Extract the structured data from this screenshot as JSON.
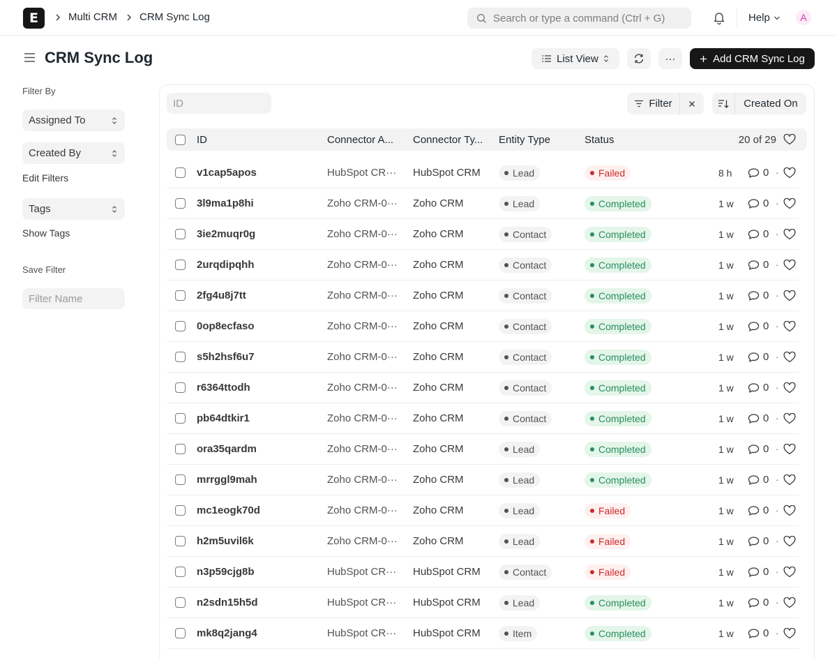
{
  "navbar": {
    "logo_letter": "E",
    "breadcrumbs": [
      "Multi CRM",
      "CRM Sync Log"
    ],
    "search_placeholder": "Search or type a command (Ctrl + G)",
    "help_label": "Help",
    "avatar_initial": "A"
  },
  "page": {
    "title": "CRM Sync Log",
    "list_view_label": "List View",
    "more_label": "···",
    "add_label": "Add CRM Sync Log"
  },
  "sidebar": {
    "filter_by_label": "Filter By",
    "assigned_to_label": "Assigned To",
    "created_by_label": "Created By",
    "edit_filters_label": "Edit Filters",
    "tags_label": "Tags",
    "show_tags_label": "Show Tags",
    "save_filter_label": "Save Filter",
    "filter_name_placeholder": "Filter Name"
  },
  "toolbar": {
    "id_placeholder": "ID",
    "filter_label": "Filter",
    "sort_label": "Created On"
  },
  "table": {
    "columns": [
      "ID",
      "Connector A...",
      "Connector Ty...",
      "Entity Type",
      "Status"
    ],
    "count_label": "20 of 29",
    "rows": [
      {
        "id": "v1cap5apos",
        "account": "HubSpot CR···",
        "type": "HubSpot CRM",
        "entity": "Lead",
        "status": "Failed",
        "status_kind": "red",
        "time": "8 h",
        "comments": "0"
      },
      {
        "id": "3l9ma1p8hi",
        "account": "Zoho CRM-0···",
        "type": "Zoho CRM",
        "entity": "Lead",
        "status": "Completed",
        "status_kind": "green",
        "time": "1 w",
        "comments": "0"
      },
      {
        "id": "3ie2muqr0g",
        "account": "Zoho CRM-0···",
        "type": "Zoho CRM",
        "entity": "Contact",
        "status": "Completed",
        "status_kind": "green",
        "time": "1 w",
        "comments": "0"
      },
      {
        "id": "2urqdipqhh",
        "account": "Zoho CRM-0···",
        "type": "Zoho CRM",
        "entity": "Contact",
        "status": "Completed",
        "status_kind": "green",
        "time": "1 w",
        "comments": "0"
      },
      {
        "id": "2fg4u8j7tt",
        "account": "Zoho CRM-0···",
        "type": "Zoho CRM",
        "entity": "Contact",
        "status": "Completed",
        "status_kind": "green",
        "time": "1 w",
        "comments": "0"
      },
      {
        "id": "0op8ecfaso",
        "account": "Zoho CRM-0···",
        "type": "Zoho CRM",
        "entity": "Contact",
        "status": "Completed",
        "status_kind": "green",
        "time": "1 w",
        "comments": "0"
      },
      {
        "id": "s5h2hsf6u7",
        "account": "Zoho CRM-0···",
        "type": "Zoho CRM",
        "entity": "Contact",
        "status": "Completed",
        "status_kind": "green",
        "time": "1 w",
        "comments": "0"
      },
      {
        "id": "r6364ttodh",
        "account": "Zoho CRM-0···",
        "type": "Zoho CRM",
        "entity": "Contact",
        "status": "Completed",
        "status_kind": "green",
        "time": "1 w",
        "comments": "0"
      },
      {
        "id": "pb64dtkir1",
        "account": "Zoho CRM-0···",
        "type": "Zoho CRM",
        "entity": "Contact",
        "status": "Completed",
        "status_kind": "green",
        "time": "1 w",
        "comments": "0"
      },
      {
        "id": "ora35qardm",
        "account": "Zoho CRM-0···",
        "type": "Zoho CRM",
        "entity": "Lead",
        "status": "Completed",
        "status_kind": "green",
        "time": "1 w",
        "comments": "0"
      },
      {
        "id": "mrrggl9mah",
        "account": "Zoho CRM-0···",
        "type": "Zoho CRM",
        "entity": "Lead",
        "status": "Completed",
        "status_kind": "green",
        "time": "1 w",
        "comments": "0"
      },
      {
        "id": "mc1eogk70d",
        "account": "Zoho CRM-0···",
        "type": "Zoho CRM",
        "entity": "Lead",
        "status": "Failed",
        "status_kind": "red",
        "time": "1 w",
        "comments": "0"
      },
      {
        "id": "h2m5uvil6k",
        "account": "Zoho CRM-0···",
        "type": "Zoho CRM",
        "entity": "Lead",
        "status": "Failed",
        "status_kind": "red",
        "time": "1 w",
        "comments": "0"
      },
      {
        "id": "n3p59cjg8b",
        "account": "HubSpot CR···",
        "type": "HubSpot CRM",
        "entity": "Contact",
        "status": "Failed",
        "status_kind": "red",
        "time": "1 w",
        "comments": "0"
      },
      {
        "id": "n2sdn15h5d",
        "account": "HubSpot CR···",
        "type": "HubSpot CRM",
        "entity": "Lead",
        "status": "Completed",
        "status_kind": "green",
        "time": "1 w",
        "comments": "0"
      },
      {
        "id": "mk8q2jang4",
        "account": "HubSpot CR···",
        "type": "HubSpot CRM",
        "entity": "Item",
        "status": "Completed",
        "status_kind": "green",
        "time": "1 w",
        "comments": "0"
      }
    ]
  },
  "colors": {
    "accent_dark": "#171717",
    "completed": "#278f5e",
    "failed": "#cc2929"
  }
}
